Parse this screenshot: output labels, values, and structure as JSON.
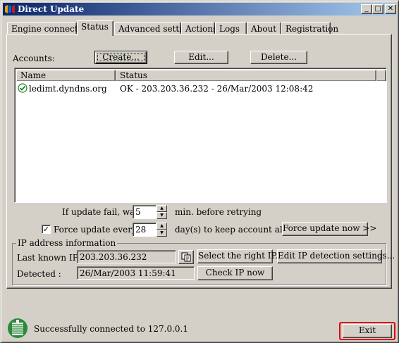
{
  "window": {
    "title": "Direct Update",
    "controls": {
      "minimize": "_",
      "maximize": "□",
      "close": "✕"
    }
  },
  "tabs": [
    {
      "label": "Engine connection"
    },
    {
      "label": "Status",
      "active": true
    },
    {
      "label": "Advanced settings"
    },
    {
      "label": "Actions"
    },
    {
      "label": "Logs"
    },
    {
      "label": "About"
    },
    {
      "label": "Registration"
    }
  ],
  "accounts": {
    "label": "Accounts:",
    "create_label": "Create...",
    "edit_label": "Edit...",
    "delete_label": "Delete...",
    "columns": [
      "Name",
      "Status"
    ],
    "rows": [
      {
        "name": "ledimt.dyndns.org",
        "status": "OK - 203.203.36.232 - 26/Mar/2003 12:08:42",
        "icon": "ok-check-icon"
      }
    ]
  },
  "retry": {
    "prefix": "If update fail, wait",
    "value": "5",
    "suffix": "min.  before retrying"
  },
  "force": {
    "checkbox_label": "Force update every:",
    "checked": true,
    "check_mark": "✓",
    "value": "28",
    "suffix": "day(s) to keep account alive",
    "button_label": "Force update now >>"
  },
  "ip": {
    "group_title": "IP address information",
    "last_known_label": "Last known IP :",
    "last_known_value": "203.203.36.232",
    "detected_label": "Detected :",
    "detected_value": "26/Mar/2003 11:59:41",
    "select_button": "Select the right IP...",
    "edit_detection_button": "Edit IP detection settings...",
    "check_button": "Check IP now"
  },
  "status_bar": {
    "message": "Successfully connected to 127.0.0.1",
    "exit_label": "Exit"
  },
  "colors": {
    "title_gradient_start": "#0a246a",
    "title_gradient_end": "#a6caf0",
    "highlight": "#e00000",
    "face": "#d4d0c8"
  }
}
